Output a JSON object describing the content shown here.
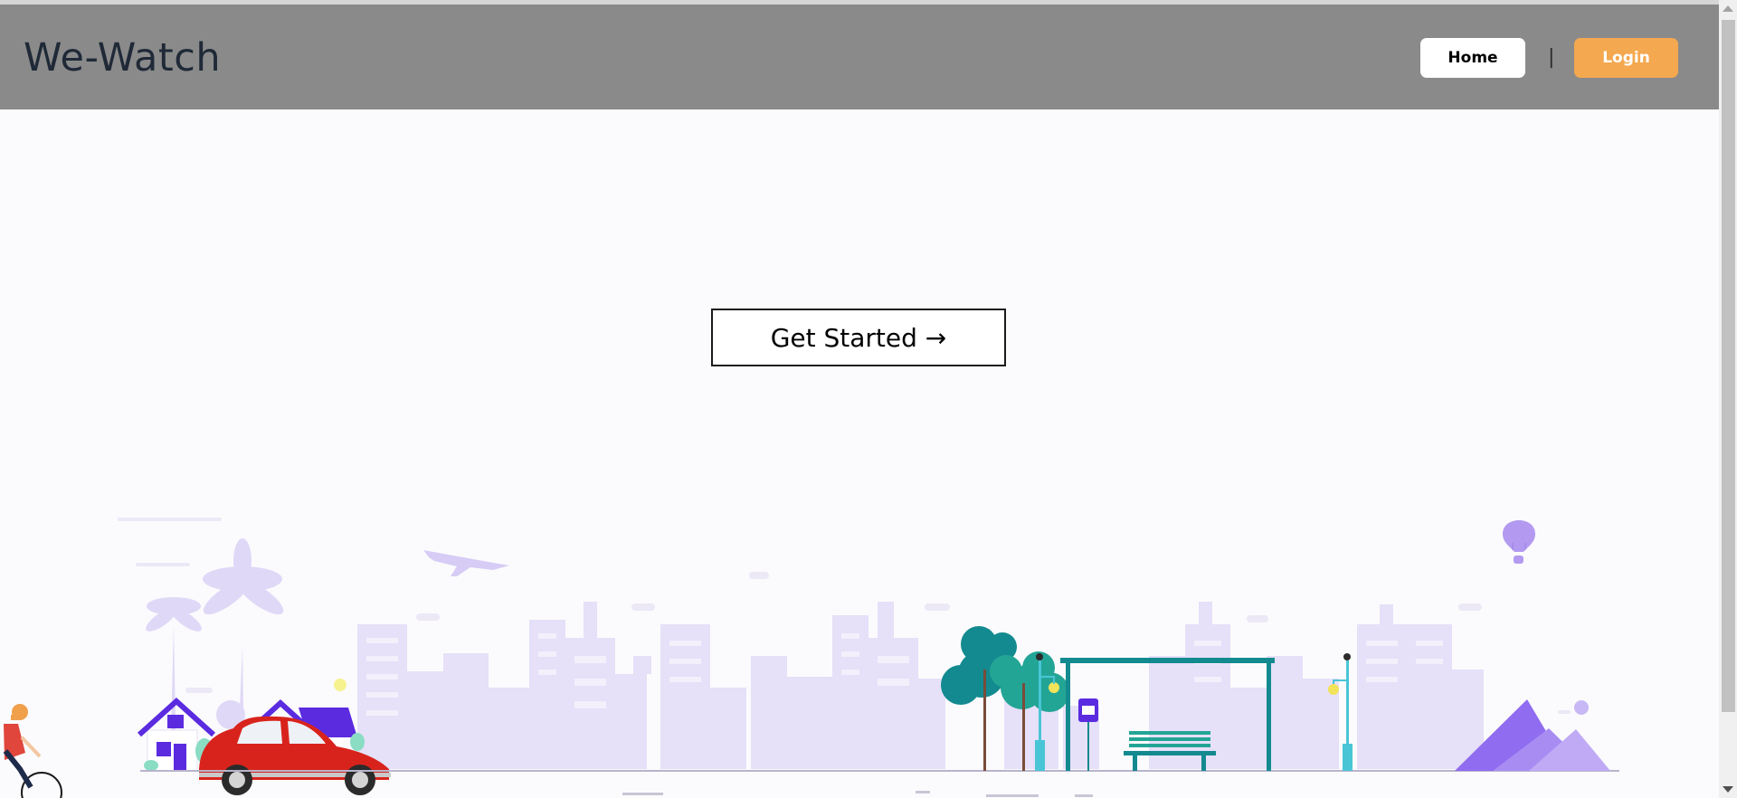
{
  "header": {
    "brand": "We-Watch",
    "nav": {
      "home_label": "Home",
      "separator": "|",
      "login_label": "Login"
    }
  },
  "hero": {
    "cta_label": "Get Started →"
  },
  "colors": {
    "header_bg": "#8a8a8a",
    "login_accent": "#f4a84f",
    "page_bg": "#fbfbfd",
    "illustration_lavender": "#e6e0f8",
    "illustration_purple": "#5b2be0",
    "illustration_teal": "#138a8f",
    "car_red": "#d8231c"
  },
  "icons": {
    "illustration": "city-skyline-illustration",
    "car": "red-beetle-car-icon",
    "cyclist": "cyclist-icon",
    "balloon": "hot-air-balloon-icon",
    "airplane": "airplane-icon"
  }
}
